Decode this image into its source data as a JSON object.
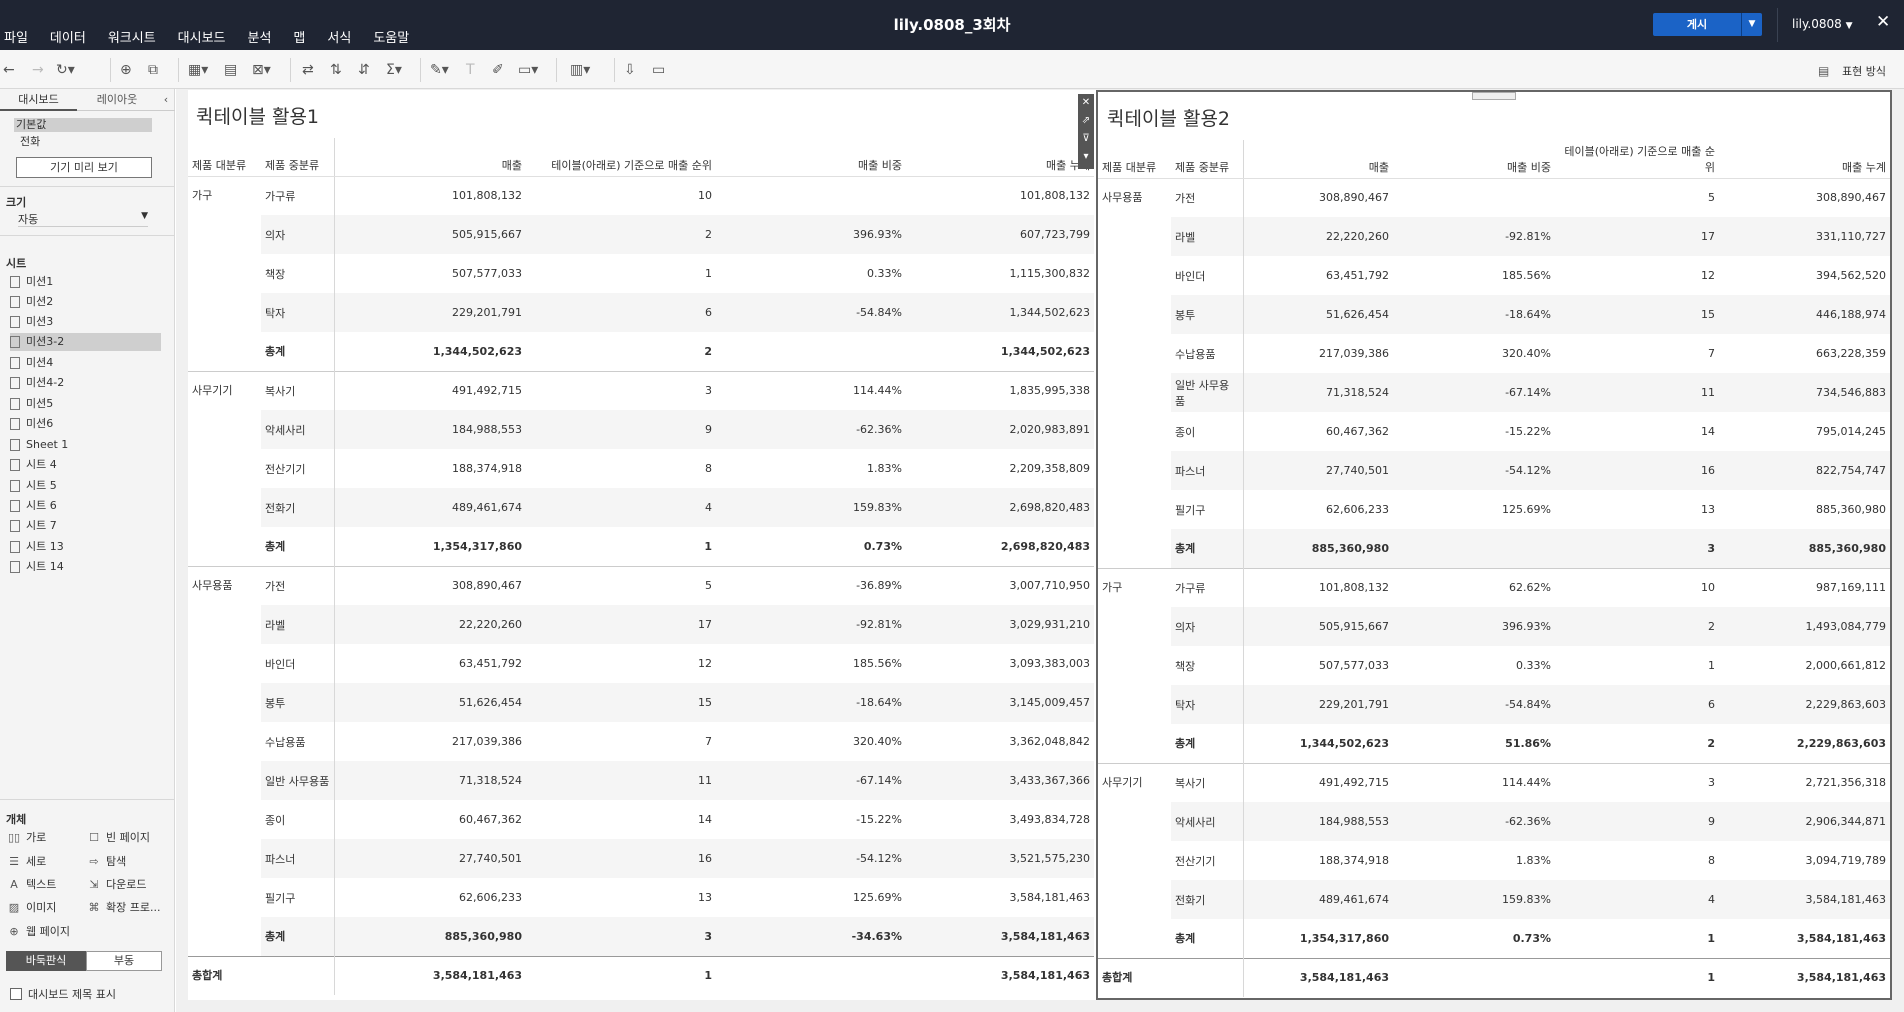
{
  "app": {
    "menus": [
      "파일",
      "데이터",
      "워크시트",
      "대시보드",
      "분석",
      "맵",
      "서식",
      "도움말"
    ],
    "title": "lily.0808_3회차",
    "publish": "게시",
    "user": "lily.0808",
    "presentation_mode": "표현 방식"
  },
  "panel": {
    "tabs": [
      "대시보드",
      "레이아웃"
    ],
    "device_items": [
      "기본값",
      "전화"
    ],
    "preview_button": "기기 미리 보기",
    "size_label": "크기",
    "size_value": "자동",
    "sheets_label": "시트",
    "sheets": [
      "미션1",
      "미션2",
      "미션3",
      "미션3-2",
      "미션4",
      "미션4-2",
      "미션5",
      "미션6",
      "Sheet 1",
      "시트 4",
      "시트 5",
      "시트 6",
      "시트 7",
      "시트 13",
      "시트 14"
    ],
    "selected_sheet": "미션3-2",
    "objects_label": "개체",
    "objects": [
      "가로",
      "빈 페이지",
      "세로",
      "탐색",
      "텍스트",
      "다운로드",
      "이미지",
      "확장 프로...",
      "웹 페이지"
    ],
    "float_toggle": [
      "바둑판식",
      "부동"
    ],
    "show_title": "대시보드 제목 표시"
  },
  "sheet1": {
    "title": "퀵테이블 활용1",
    "headers": [
      "제품 대분류",
      "제품 중분류",
      "매출",
      "테이블(아래로) 기준으로 매출 순위",
      "매출 비중",
      "매출 누계"
    ],
    "rows": [
      [
        "가구",
        "가구류",
        "101,808,132",
        "10",
        "",
        "101,808,132"
      ],
      [
        "",
        "의자",
        "505,915,667",
        "2",
        "396.93%",
        "607,723,799"
      ],
      [
        "",
        "책장",
        "507,577,033",
        "1",
        "0.33%",
        "1,115,300,832"
      ],
      [
        "",
        "탁자",
        "229,201,791",
        "6",
        "-54.84%",
        "1,344,502,623"
      ],
      [
        "",
        "총계",
        "1,344,502,623",
        "2",
        "",
        "1,344,502,623"
      ],
      [
        "사무기기",
        "복사기",
        "491,492,715",
        "3",
        "114.44%",
        "1,835,995,338"
      ],
      [
        "",
        "악세사리",
        "184,988,553",
        "9",
        "-62.36%",
        "2,020,983,891"
      ],
      [
        "",
        "전산기기",
        "188,374,918",
        "8",
        "1.83%",
        "2,209,358,809"
      ],
      [
        "",
        "전화기",
        "489,461,674",
        "4",
        "159.83%",
        "2,698,820,483"
      ],
      [
        "",
        "총계",
        "1,354,317,860",
        "1",
        "0.73%",
        "2,698,820,483"
      ],
      [
        "사무용품",
        "가전",
        "308,890,467",
        "5",
        "-36.89%",
        "3,007,710,950"
      ],
      [
        "",
        "라벨",
        "22,220,260",
        "17",
        "-92.81%",
        "3,029,931,210"
      ],
      [
        "",
        "바인더",
        "63,451,792",
        "12",
        "185.56%",
        "3,093,383,003"
      ],
      [
        "",
        "봉투",
        "51,626,454",
        "15",
        "-18.64%",
        "3,145,009,457"
      ],
      [
        "",
        "수납용품",
        "217,039,386",
        "7",
        "320.40%",
        "3,362,048,842"
      ],
      [
        "",
        "일반 사무용품",
        "71,318,524",
        "11",
        "-67.14%",
        "3,433,367,366"
      ],
      [
        "",
        "종이",
        "60,467,362",
        "14",
        "-15.22%",
        "3,493,834,728"
      ],
      [
        "",
        "파스너",
        "27,740,501",
        "16",
        "-54.12%",
        "3,521,575,230"
      ],
      [
        "",
        "필기구",
        "62,606,233",
        "13",
        "125.69%",
        "3,584,181,463"
      ],
      [
        "",
        "총계",
        "885,360,980",
        "3",
        "-34.63%",
        "3,584,181,463"
      ]
    ],
    "grand": [
      "총합계",
      "",
      "3,584,181,463",
      "1",
      "",
      "3,584,181,463"
    ]
  },
  "sheet2": {
    "title": "퀵테이블 활용2",
    "headers": [
      "제품 대분류",
      "제품 중분류",
      "매출",
      "매출 비중",
      "테이블(아래로) 기준으로 매출 순위",
      "매출 누계"
    ],
    "rows": [
      [
        "사무용품",
        "가전",
        "308,890,467",
        "",
        "5",
        "308,890,467"
      ],
      [
        "",
        "라벨",
        "22,220,260",
        "-92.81%",
        "17",
        "331,110,727"
      ],
      [
        "",
        "바인더",
        "63,451,792",
        "185.56%",
        "12",
        "394,562,520"
      ],
      [
        "",
        "봉투",
        "51,626,454",
        "-18.64%",
        "15",
        "446,188,974"
      ],
      [
        "",
        "수납용품",
        "217,039,386",
        "320.40%",
        "7",
        "663,228,359"
      ],
      [
        "",
        "일반 사무용품",
        "71,318,524",
        "-67.14%",
        "11",
        "734,546,883"
      ],
      [
        "",
        "종이",
        "60,467,362",
        "-15.22%",
        "14",
        "795,014,245"
      ],
      [
        "",
        "파스너",
        "27,740,501",
        "-54.12%",
        "16",
        "822,754,747"
      ],
      [
        "",
        "필기구",
        "62,606,233",
        "125.69%",
        "13",
        "885,360,980"
      ],
      [
        "",
        "총계",
        "885,360,980",
        "",
        "3",
        "885,360,980"
      ],
      [
        "가구",
        "가구류",
        "101,808,132",
        "62.62%",
        "10",
        "987,169,111"
      ],
      [
        "",
        "의자",
        "505,915,667",
        "396.93%",
        "2",
        "1,493,084,779"
      ],
      [
        "",
        "책장",
        "507,577,033",
        "0.33%",
        "1",
        "2,000,661,812"
      ],
      [
        "",
        "탁자",
        "229,201,791",
        "-54.84%",
        "6",
        "2,229,863,603"
      ],
      [
        "",
        "총계",
        "1,344,502,623",
        "51.86%",
        "2",
        "2,229,863,603"
      ],
      [
        "사무기기",
        "복사기",
        "491,492,715",
        "114.44%",
        "3",
        "2,721,356,318"
      ],
      [
        "",
        "악세사리",
        "184,988,553",
        "-62.36%",
        "9",
        "2,906,344,871"
      ],
      [
        "",
        "전산기기",
        "188,374,918",
        "1.83%",
        "8",
        "3,094,719,789"
      ],
      [
        "",
        "전화기",
        "489,461,674",
        "159.83%",
        "4",
        "3,584,181,463"
      ],
      [
        "",
        "총계",
        "1,354,317,860",
        "0.73%",
        "1",
        "3,584,181,463"
      ]
    ],
    "grand": [
      "총합계",
      "",
      "3,584,181,463",
      "",
      "1",
      "3,584,181,463"
    ]
  }
}
